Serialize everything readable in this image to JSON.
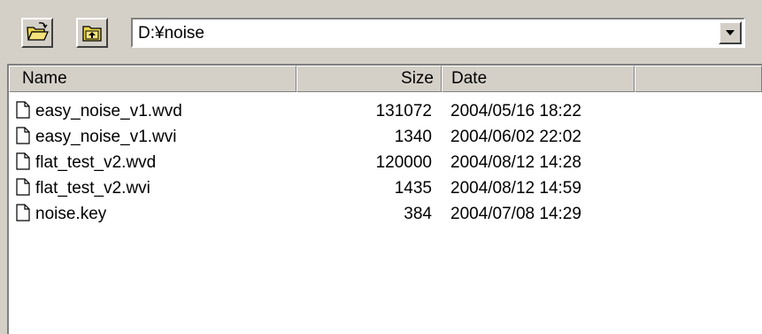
{
  "toolbar": {
    "open_icon": "open-folder-icon",
    "up_icon": "up-folder-icon",
    "path_value": "D:¥noise",
    "dropdown_icon": "chevron-down-icon"
  },
  "list": {
    "columns": {
      "name": "Name",
      "size": "Size",
      "date": "Date"
    },
    "file_icon": "file-icon",
    "rows": [
      {
        "name": "easy_noise_v1.wvd",
        "size": "131072",
        "date": "2004/05/16 18:22"
      },
      {
        "name": "easy_noise_v1.wvi",
        "size": "1340",
        "date": "2004/06/02 22:02"
      },
      {
        "name": "flat_test_v2.wvd",
        "size": "120000",
        "date": "2004/08/12 14:28"
      },
      {
        "name": "flat_test_v2.wvi",
        "size": "1435",
        "date": "2004/08/12 14:59"
      },
      {
        "name": "noise.key",
        "size": "384",
        "date": "2004/07/08 14:29"
      }
    ]
  }
}
